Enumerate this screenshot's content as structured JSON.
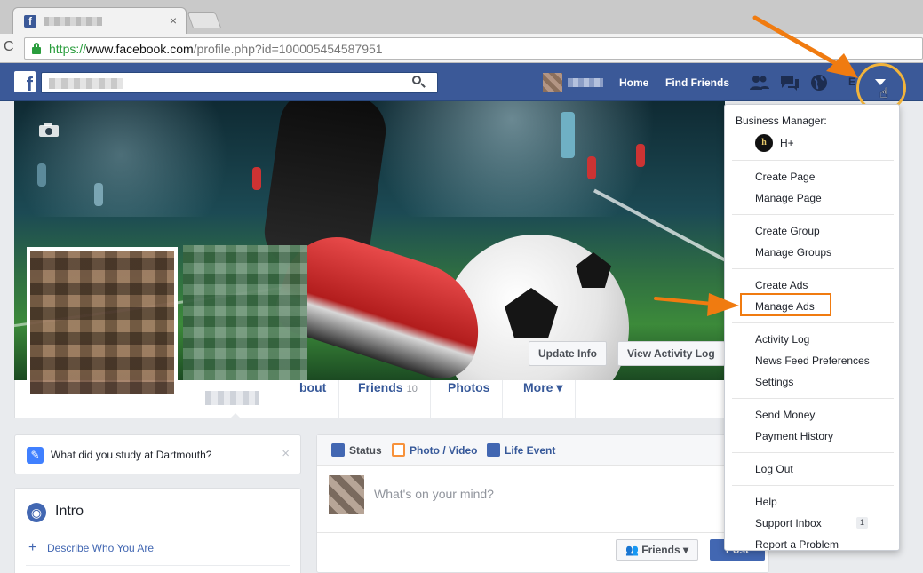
{
  "browser": {
    "tab_favicon": "f",
    "tab_close": "×",
    "url_scheme": "https://",
    "url_host": "www.facebook.com",
    "url_path": "/profile.php?id=100005454587951"
  },
  "fbbar": {
    "logo": "f",
    "home": "Home",
    "find_friends": "Find Friends",
    "icons": [
      "friend-requests-icon",
      "messages-icon",
      "notifications-globe-icon",
      "quick-help-icon",
      "account-menu-caret-icon"
    ]
  },
  "cover": {
    "update_info": "Update Info",
    "view_activity_log": "View Activity Log"
  },
  "timeline_nav": {
    "about_partial": "bout",
    "friends": "Friends",
    "friends_count": "10",
    "photos": "Photos",
    "more": "More ▾"
  },
  "prompt": {
    "text": "What did you study at Dartmouth?",
    "close": "×"
  },
  "intro": {
    "heading": "Intro",
    "describe": "Describe Who You Are"
  },
  "composer": {
    "tabs": [
      "Status",
      "Photo / Video",
      "Life Event"
    ],
    "placeholder": "What's on your mind?",
    "audience": "Friends ▾",
    "post": "Post"
  },
  "menu": {
    "business_manager_label": "Business Manager:",
    "business_logo": "h",
    "business_name": "H+",
    "groups": [
      [
        "Create Page",
        "Manage Page"
      ],
      [
        "Create Group",
        "Manage Groups"
      ],
      [
        "Create Ads",
        "Manage Ads"
      ],
      [
        "Activity Log",
        "News Feed Preferences",
        "Settings"
      ],
      [
        "Send Money",
        "Payment History"
      ],
      [
        "Log Out"
      ],
      [
        "Help",
        "Support Inbox",
        "Report a Problem"
      ]
    ],
    "support_inbox_badge": "1"
  },
  "colors": {
    "fb_blue": "#3b5998",
    "annotation_orange": "#f07b10",
    "highlight_yellow": "#f2b43b"
  }
}
